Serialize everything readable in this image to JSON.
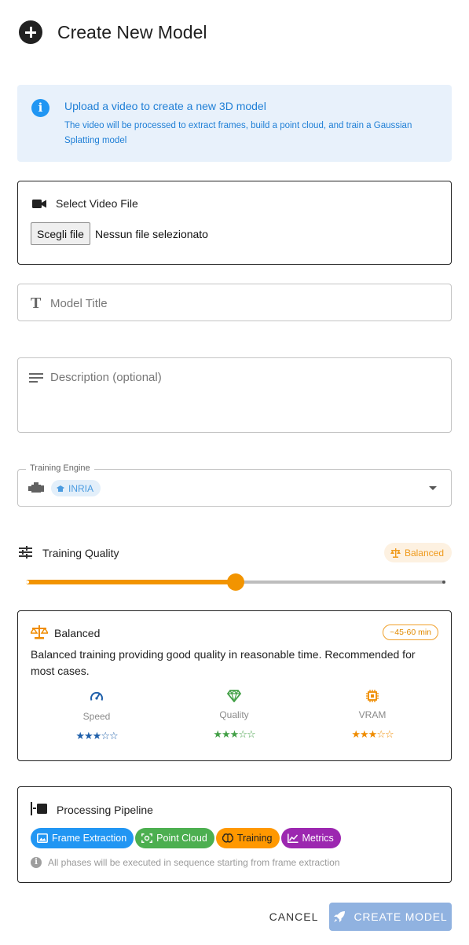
{
  "header": {
    "title": "Create New Model",
    "icon": "add-circle-icon"
  },
  "info": {
    "title": "Upload a video to create a new 3D model",
    "text": "The video will be processed to extract frames, build a point cloud, and train a Gaussian Splatting model",
    "icon": "info-icon"
  },
  "video": {
    "label": "Select Video File",
    "button": "Scegli file",
    "status": "Nessun file selezionato"
  },
  "fields": {
    "title_placeholder": "Model Title",
    "description_placeholder": "Description (optional)"
  },
  "engine": {
    "legend": "Training Engine",
    "selected": "INRIA"
  },
  "quality": {
    "label": "Training Quality",
    "badge": "Balanced",
    "slider_fraction": 0.5,
    "accent": "#f29400"
  },
  "preset": {
    "name": "Balanced",
    "time": "~45-60 min",
    "description": "Balanced training providing good quality in reasonable time. Recommended for most cases.",
    "metrics": [
      {
        "label": "Speed",
        "stars": "★★★☆☆",
        "rating": 3,
        "color": "#1e5faa",
        "icon": "speedometer-icon"
      },
      {
        "label": "Quality",
        "stars": "★★★☆☆",
        "rating": 3,
        "color": "#43a047",
        "icon": "diamond-icon"
      },
      {
        "label": "VRAM",
        "stars": "★★★☆☆",
        "rating": 3,
        "color": "#ef8c00",
        "icon": "chip-icon"
      }
    ]
  },
  "pipeline": {
    "title": "Processing Pipeline",
    "phases": [
      {
        "label": "Frame Extraction",
        "color": "#2196f3",
        "icon": "image-icon"
      },
      {
        "label": "Point Cloud",
        "color": "#4caf50",
        "icon": "scan-icon"
      },
      {
        "label": "Training",
        "color": "#ff9800",
        "icon": "brain-icon"
      },
      {
        "label": "Metrics",
        "color": "#9c27b0",
        "icon": "chart-line-icon"
      }
    ],
    "note": "All phases will be executed in sequence starting from frame extraction"
  },
  "actions": {
    "cancel": "CANCEL",
    "create": "CREATE MODEL"
  }
}
